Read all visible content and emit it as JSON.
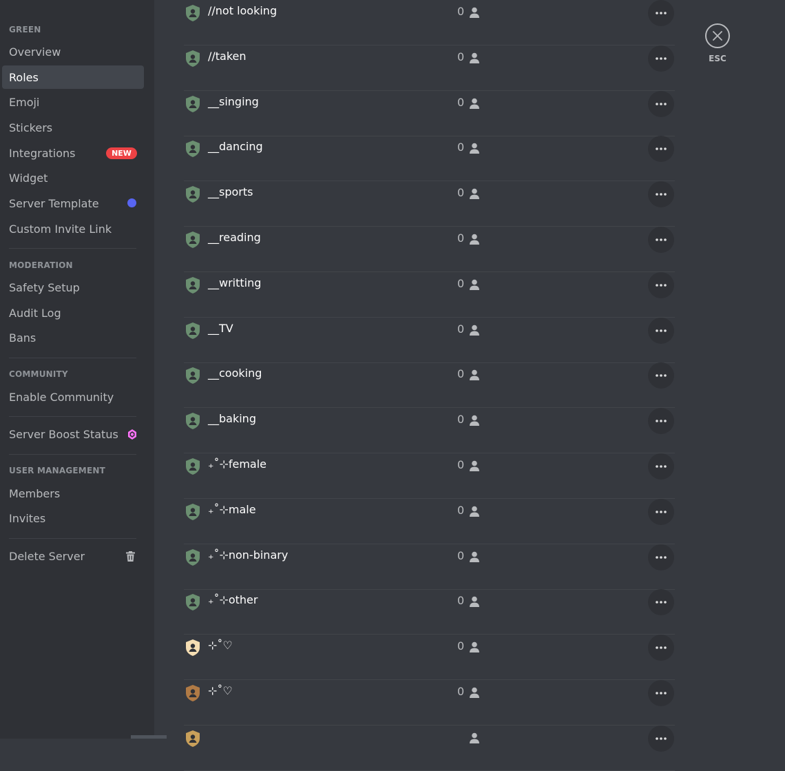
{
  "sidebar": {
    "sections": [
      {
        "header": "GREEN"
      },
      {
        "header": "MODERATION"
      },
      {
        "header": "COMMUNITY"
      },
      {
        "header": "USER MANAGEMENT"
      }
    ],
    "items": {
      "overview": "Overview",
      "roles": "Roles",
      "emoji": "Emoji",
      "stickers": "Stickers",
      "integrations": "Integrations",
      "widget": "Widget",
      "server_template": "Server Template",
      "custom_invite_link": "Custom Invite Link",
      "safety_setup": "Safety Setup",
      "audit_log": "Audit Log",
      "bans": "Bans",
      "enable_community": "Enable Community",
      "server_boost_status": "Server Boost Status",
      "members": "Members",
      "invites": "Invites",
      "delete_server": "Delete Server"
    },
    "badge_new": "NEW",
    "active_item": "Roles"
  },
  "roles": [
    {
      "name": "//not looking",
      "count": "0",
      "color": "#6b8f71"
    },
    {
      "name": "//taken",
      "count": "0",
      "color": "#6b8f71"
    },
    {
      "name": "__singing",
      "count": "0",
      "color": "#6b8f71"
    },
    {
      "name": "__dancing",
      "count": "0",
      "color": "#6b8f71"
    },
    {
      "name": "__sports",
      "count": "0",
      "color": "#6b8f71"
    },
    {
      "name": "__reading",
      "count": "0",
      "color": "#6b8f71"
    },
    {
      "name": "__writting",
      "count": "0",
      "color": "#6b8f71"
    },
    {
      "name": "__TV",
      "count": "0",
      "color": "#6b8f71"
    },
    {
      "name": "__cooking",
      "count": "0",
      "color": "#6b8f71"
    },
    {
      "name": "__baking",
      "count": "0",
      "color": "#6b8f71"
    },
    {
      "name": "₊˚⊹female",
      "count": "0",
      "color": "#6b8f71"
    },
    {
      "name": "₊˚⊹male",
      "count": "0",
      "color": "#6b8f71"
    },
    {
      "name": "₊˚⊹non-binary",
      "count": "0",
      "color": "#6b8f71"
    },
    {
      "name": "₊˚⊹other",
      "count": "0",
      "color": "#6b8f71"
    },
    {
      "name": "⊹˚♡",
      "count": "0",
      "color": "#f5deb3"
    },
    {
      "name": "⊹˚♡",
      "count": "0",
      "color": "#b07a45"
    },
    {
      "name": "",
      "count": "",
      "color": "#c9a05a"
    }
  ],
  "close": {
    "label": "ESC"
  },
  "colors": {
    "sidebar_bg": "#2f3136",
    "content_bg": "#36393f",
    "new_badge": "#ed4245",
    "template_dot": "#5865f2",
    "boost": "#ff73fa"
  },
  "icons": [
    "shield-user-icon",
    "person-icon",
    "more-dots-icon",
    "close-icon",
    "boost-gem-icon",
    "trash-icon"
  ]
}
